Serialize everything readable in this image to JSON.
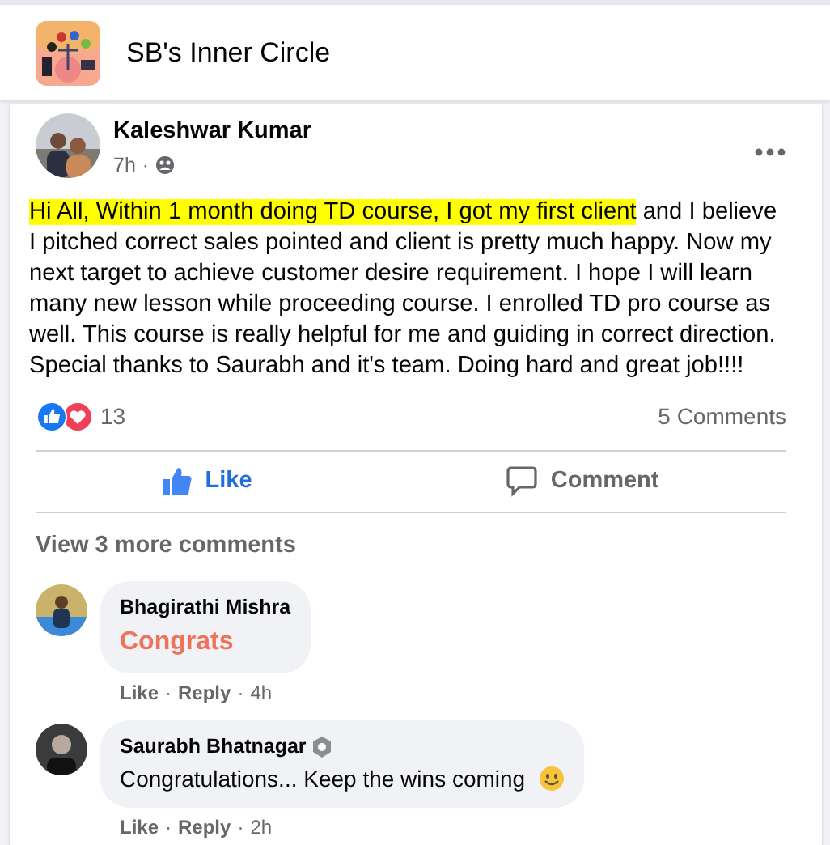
{
  "group": {
    "name": "SB's Inner Circle"
  },
  "post": {
    "author": "Kaleshwar Kumar",
    "time": "7h",
    "time_separator": "·",
    "body": [
      {
        "text": "Hi All, Within 1 month doing TD course,  I got my first client",
        "highlighted": true
      },
      {
        "text": " and I believe I pitched correct sales pointed and client is pretty much happy. Now my next target to achieve customer desire requirement. I hope I will learn many new lesson while proceeding course. I enrolled TD pro course as well. This course is really helpful for me and guiding in correct direction.",
        "highlighted": false
      }
    ],
    "closing": "Special thanks to Saurabh and it's team. Doing hard and great job!!!!",
    "reaction_count": "13",
    "comments_count": "5 Comments",
    "actions": [
      {
        "label": "Like",
        "kind": "like",
        "selected": true
      },
      {
        "label": "Comment",
        "kind": "comment",
        "selected": false
      }
    ]
  },
  "view_more": "View 3 more comments",
  "comments": [
    {
      "author": "Bhagirathi Mishra",
      "text": "Congrats",
      "emphasized": true,
      "admin_badge": false,
      "emoji": false,
      "meta": [
        {
          "text": "Like",
          "kind": "link"
        },
        {
          "text": "·",
          "kind": "separator"
        },
        {
          "text": "Reply",
          "kind": "link"
        },
        {
          "text": "·",
          "kind": "separator"
        },
        {
          "text": "4h",
          "kind": "time"
        }
      ]
    },
    {
      "author": "Saurabh Bhatnagar",
      "text": "Congratulations... Keep the wins coming",
      "emphasized": false,
      "admin_badge": true,
      "emoji": true,
      "meta": [
        {
          "text": "Like",
          "kind": "link"
        },
        {
          "text": "·",
          "kind": "separator"
        },
        {
          "text": "Reply",
          "kind": "link"
        },
        {
          "text": "·",
          "kind": "separator"
        },
        {
          "text": "2h",
          "kind": "time"
        }
      ]
    }
  ]
}
